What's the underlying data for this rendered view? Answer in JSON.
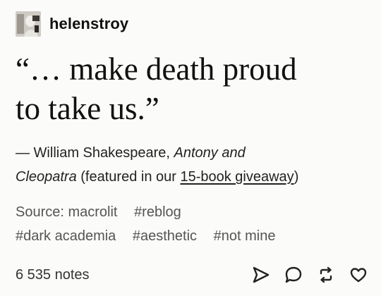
{
  "post": {
    "username": "helenstroy",
    "quote_line1": "“… make death proud",
    "quote_line2": "to take us.”",
    "attribution": {
      "prefix": "— William Shakespeare, ",
      "work_part1": "Antony and",
      "work_part2": "Cleopatra",
      "mid": " (featured in our ",
      "link": "15-book giveaway",
      "suffix": ")"
    },
    "source": "Source: macrolit",
    "tags": [
      "#reblog",
      "#dark academia",
      "#aesthetic",
      "#not mine"
    ],
    "notes": "6 535 notes"
  },
  "icons": {
    "avatar": "avatar-image",
    "share": "paper-plane-icon",
    "reply": "speech-bubble-icon",
    "reblog": "reblog-icon",
    "like": "heart-icon"
  }
}
